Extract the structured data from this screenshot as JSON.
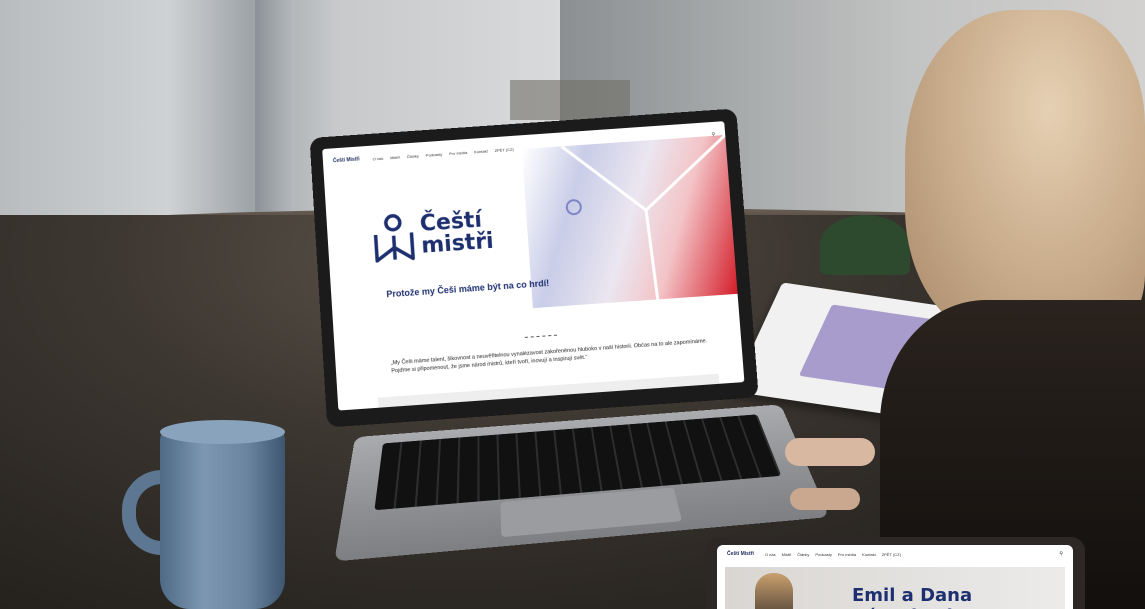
{
  "laptop_site": {
    "brand": "Čeští Mistři",
    "nav": [
      "O nás",
      "Mistři",
      "Články",
      "Podcasty",
      "Pro média",
      "Kontakt",
      "ZPĚT (CZ)"
    ],
    "logo_line1": "Čeští",
    "logo_line2": "mistři",
    "tagline": "Protože my Češi máme být na co hrdí!",
    "quote": "„My Češi máme talent, šikovnost a neuvěřitelnou vynalézavost zakořeněnou hluboko v naší historii. Občas na to ale zapomínáme. Pojďme si připomenout, že jsme národ mistrů, kteří tvoří, inovují a inspirují svět.“",
    "search_icon": "search-icon"
  },
  "tablet_site": {
    "brand": "Čeští Mistři",
    "nav": [
      "O nás",
      "Mistři",
      "Články",
      "Podcasty",
      "Pro média",
      "Kontakt",
      "ZPĚT (CZ)"
    ],
    "title": "Emil a Dana Zátopkovi",
    "search_icon": "search-icon"
  },
  "colors": {
    "brand_blue": "#1d2f6f",
    "accent_red": "#d41e2a"
  }
}
